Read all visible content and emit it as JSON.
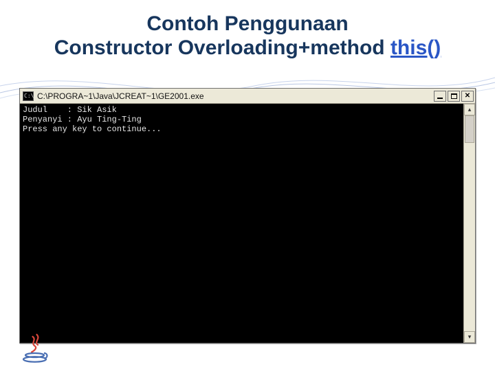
{
  "title": {
    "line1": "Contoh Penggunaan",
    "line2_prefix": "Constructor Overloading+method ",
    "line2_accent": "this()"
  },
  "console": {
    "title": "C:\\PROGRA~1\\Java\\JCREAT~1\\GE2001.exe",
    "lines": [
      "Judul    : Sik Asik",
      "Penyanyi : Ayu Ting-Ting",
      "Press any key to continue..."
    ],
    "scroll": {
      "up": "▴",
      "down": "▾"
    }
  }
}
